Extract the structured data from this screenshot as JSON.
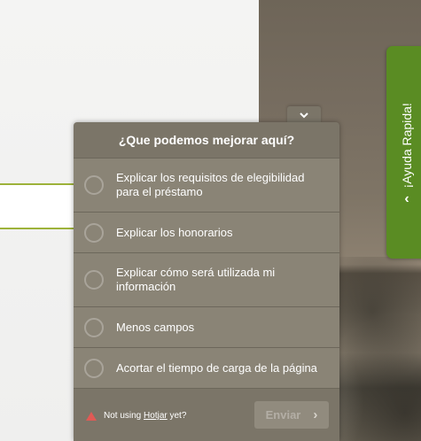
{
  "quick_help": {
    "label": "¡Ayuda Rapida!"
  },
  "feedback": {
    "title": "¿Que podemos mejorar aquí?",
    "options": [
      {
        "label": "Explicar los requisitos de elegibilidad para el préstamo"
      },
      {
        "label": "Explicar los honorarios"
      },
      {
        "label": "Explicar cómo será utilizada mi información"
      },
      {
        "label": "Menos campos"
      },
      {
        "label": "Acortar el tiempo de carga de la página"
      }
    ],
    "footer": {
      "prefix": "Not using ",
      "link": "Hotjar",
      "suffix": " yet?"
    },
    "submit_label": "Enviar"
  },
  "colors": {
    "widget_bg": "#7b7568",
    "option_bg": "#8a8476",
    "quick_help_bg": "#5a8c23",
    "input_border": "#9db23a"
  },
  "icons": [
    "chevron-down-icon",
    "chevron-up-icon",
    "hotjar-logo-icon",
    "chevron-right-icon"
  ]
}
